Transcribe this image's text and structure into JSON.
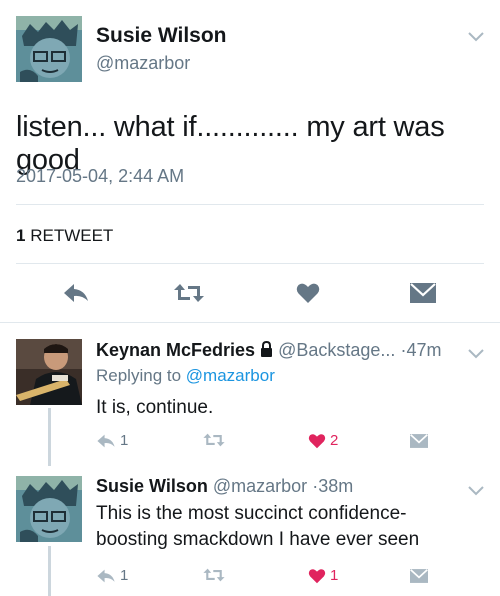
{
  "tweet": {
    "author_name": "Susie Wilson",
    "author_handle": "@mazarbor",
    "text": "listen... what if............. my art was good",
    "timestamp": "2017-05-04, 2:44 AM",
    "retweet_count": "1",
    "retweet_label": "RETWEET"
  },
  "replies": [
    {
      "author_name": "Keynan McFedries",
      "author_handle": "@Backstage...",
      "time": "47m",
      "replying_to_label": "Replying to",
      "replying_to_handle": "@mazarbor",
      "text": "It is, continue.",
      "reply_count": "1",
      "like_count": "2"
    },
    {
      "author_name": "Susie Wilson",
      "author_handle": "@mazarbor",
      "time": "38m",
      "text": "This is the most succinct confidence-boosting smackdown I have ever seen",
      "reply_count": "1",
      "like_count": "1"
    }
  ],
  "colors": {
    "text": "#14171a",
    "muted": "#657786",
    "link": "#1b95e0",
    "like": "#e0245e",
    "icon": "#657786",
    "icon_light": "#aab8c2",
    "border": "#e1e8ed"
  }
}
